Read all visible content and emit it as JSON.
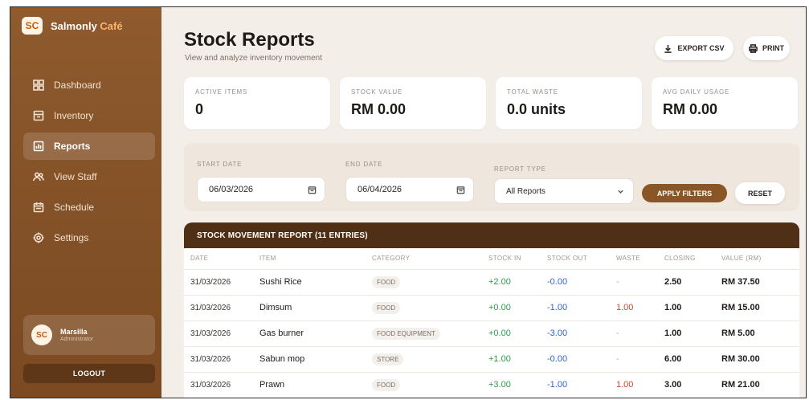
{
  "brand": {
    "logo_text": "SC",
    "name_part1": "Salmonly",
    "name_part2": "Café"
  },
  "sidebar": {
    "items": [
      {
        "label": "Dashboard",
        "icon": "dashboard-icon"
      },
      {
        "label": "Inventory",
        "icon": "box-icon"
      },
      {
        "label": "Reports",
        "icon": "chart-icon"
      },
      {
        "label": "View Staff",
        "icon": "users-icon"
      },
      {
        "label": "Schedule",
        "icon": "calendar-icon"
      },
      {
        "label": "Settings",
        "icon": "gear-icon"
      }
    ],
    "active_index": 2,
    "user": {
      "name": "Marsilla",
      "role": "Administrator",
      "avatar_text": "SC"
    },
    "logout_label": "LOGOUT"
  },
  "header": {
    "title": "Stock Reports",
    "subtitle": "View and analyze inventory movement",
    "export_label": "EXPORT CSV",
    "print_label": "PRINT"
  },
  "stats": [
    {
      "label": "ACTIVE ITEMS",
      "value": "0"
    },
    {
      "label": "STOCK VALUE",
      "value": "RM 0.00"
    },
    {
      "label": "TOTAL WASTE",
      "value": "0.0 units"
    },
    {
      "label": "AVG DAILY USAGE",
      "value": "RM 0.00"
    }
  ],
  "filters": {
    "start_label": "START DATE",
    "start_value": "06/03/2026",
    "end_label": "END DATE",
    "end_value": "06/04/2026",
    "type_label": "REPORT TYPE",
    "type_value": "All Reports",
    "apply_label": "APPLY FILTERS",
    "reset_label": "RESET"
  },
  "report": {
    "title": "STOCK MOVEMENT REPORT (11 ENTRIES)",
    "columns": [
      "DATE",
      "ITEM",
      "CATEGORY",
      "STOCK IN",
      "STOCK OUT",
      "WASTE",
      "CLOSING",
      "VALUE (RM)"
    ],
    "rows": [
      {
        "date": "31/03/2026",
        "item": "Sushi Rice",
        "category": "FOOD",
        "stock_in": "+2.00",
        "stock_out": "-0.00",
        "waste": "-",
        "closing": "2.50",
        "value": "RM 37.50"
      },
      {
        "date": "31/03/2026",
        "item": "Dimsum",
        "category": "FOOD",
        "stock_in": "+0.00",
        "stock_out": "-1.00",
        "waste": "1.00",
        "closing": "1.00",
        "value": "RM 15.00"
      },
      {
        "date": "31/03/2026",
        "item": "Gas burner",
        "category": "FOOD EQUIPMENT",
        "stock_in": "+0.00",
        "stock_out": "-3.00",
        "waste": "-",
        "closing": "1.00",
        "value": "RM 5.00"
      },
      {
        "date": "31/03/2026",
        "item": "Sabun mop",
        "category": "STORE",
        "stock_in": "+1.00",
        "stock_out": "-0.00",
        "waste": "-",
        "closing": "6.00",
        "value": "RM 30.00"
      },
      {
        "date": "31/03/2026",
        "item": "Prawn",
        "category": "FOOD",
        "stock_in": "+3.00",
        "stock_out": "-1.00",
        "waste": "1.00",
        "closing": "3.00",
        "value": "RM 21.00"
      }
    ]
  }
}
